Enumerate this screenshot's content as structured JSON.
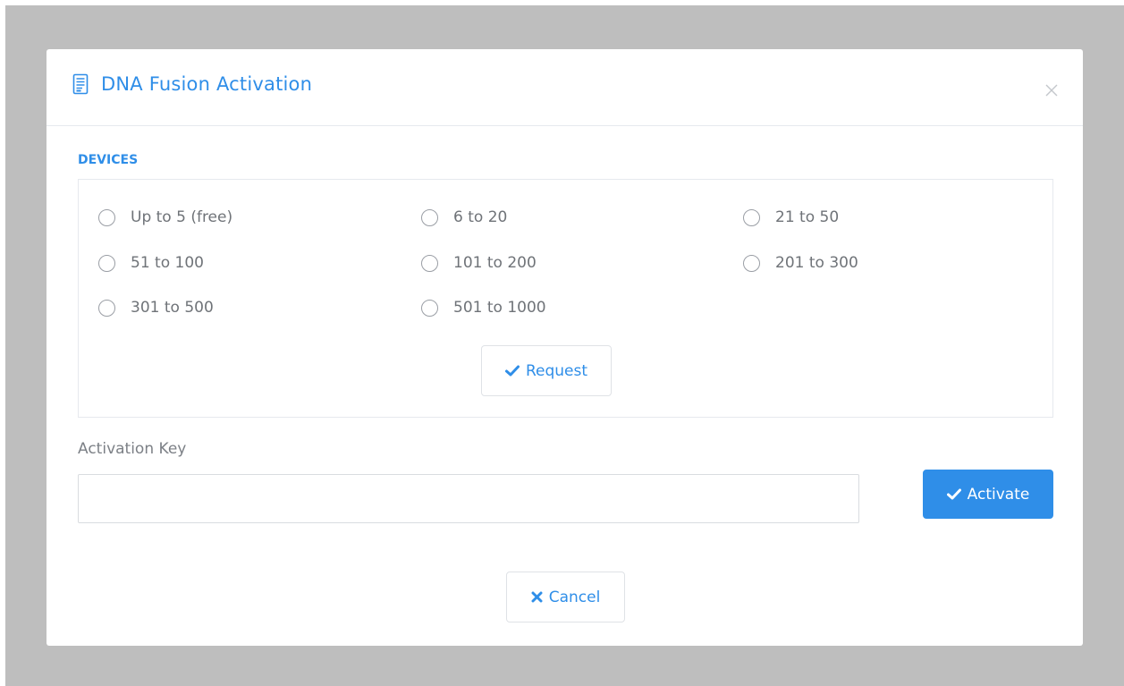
{
  "dialog": {
    "title": "DNA Fusion Activation",
    "title_icon": "document-icon",
    "close_icon": "close-icon"
  },
  "devices": {
    "label": "DEVICES",
    "options": [
      {
        "label": "Up to 5 (free)",
        "selected": false
      },
      {
        "label": "6 to 20",
        "selected": false
      },
      {
        "label": "21 to 50",
        "selected": false
      },
      {
        "label": "51 to 100",
        "selected": false
      },
      {
        "label": "101 to 200",
        "selected": false
      },
      {
        "label": "201 to 300",
        "selected": false
      },
      {
        "label": "301 to 500",
        "selected": false
      },
      {
        "label": "501 to 1000",
        "selected": false
      }
    ],
    "request_button": "Request"
  },
  "activation": {
    "label": "Activation Key",
    "value": "",
    "placeholder": "",
    "activate_button": "Activate"
  },
  "footer": {
    "cancel_button": "Cancel"
  },
  "colors": {
    "accent": "#2f8ee8",
    "backdrop": "#bebebe",
    "border": "#e6e9ee",
    "muted_text": "#6f7378"
  }
}
